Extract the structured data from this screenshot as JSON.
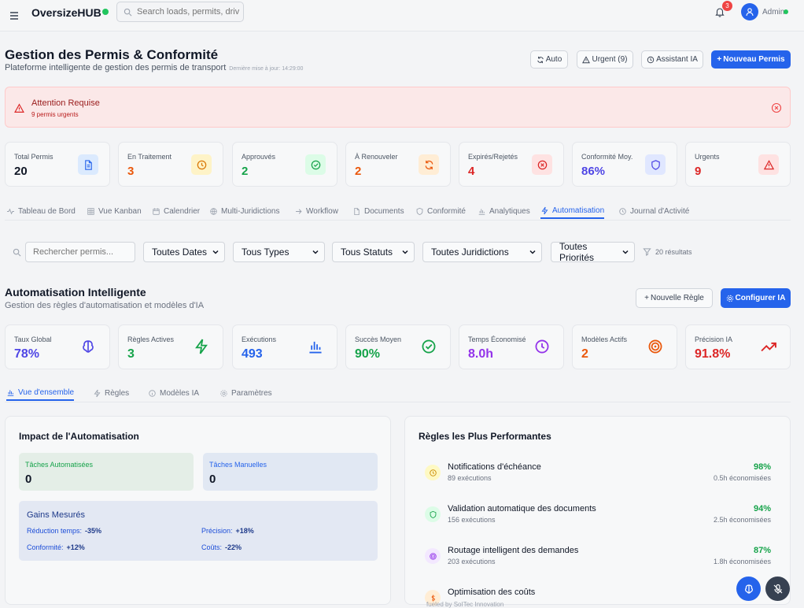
{
  "app": {
    "brand": "OversizeHUB",
    "search_placeholder": "Search loads, permits, drivers...",
    "notif_count": "3",
    "user": "Admin"
  },
  "header": {
    "title": "Gestion des Permis & Conformité",
    "subtitle": "Plateforme intelligente de gestion des permis de transport",
    "last_update": "Dernière mise à jour: 14:29:00"
  },
  "actions": {
    "auto": "Auto",
    "urgent": "Urgent (9)",
    "assistant": "Assistant IA",
    "new_permit": "Nouveau Permis"
  },
  "alert": {
    "title": "Attention Requise",
    "message": "9 permis urgents"
  },
  "stats": [
    {
      "label": "Total Permis",
      "value": "20",
      "icon": "document-icon",
      "color": "#111827",
      "bg": "#dbeafe",
      "ic": "#2563eb"
    },
    {
      "label": "En Traitement",
      "value": "3",
      "icon": "clock-icon",
      "color": "#ea580c",
      "bg": "#fef3c7",
      "ic": "#d97706"
    },
    {
      "label": "Approuvés",
      "value": "2",
      "icon": "check-circle-icon",
      "color": "#16a34a",
      "bg": "#dcfce7",
      "ic": "#16a34a"
    },
    {
      "label": "À Renouveler",
      "value": "2",
      "icon": "refresh-icon",
      "color": "#ea580c",
      "bg": "#ffedd5",
      "ic": "#ea580c"
    },
    {
      "label": "Expirés/Rejetés",
      "value": "4",
      "icon": "x-circle-icon",
      "color": "#dc2626",
      "bg": "#fee2e2",
      "ic": "#dc2626"
    },
    {
      "label": "Conformité Moy.",
      "value": "86%",
      "icon": "shield-icon",
      "color": "#4f46e5",
      "bg": "#e0e7ff",
      "ic": "#4f46e5"
    },
    {
      "label": "Urgents",
      "value": "9",
      "icon": "warning-icon",
      "color": "#dc2626",
      "bg": "#fee2e2",
      "ic": "#dc2626"
    }
  ],
  "tabs": [
    "Tableau de Bord",
    "Vue Kanban",
    "Calendrier",
    "Multi-Juridictions",
    "Workflow",
    "Documents",
    "Conformité",
    "Analytiques",
    "Automatisation",
    "Journal d'Activité"
  ],
  "filters": {
    "search_placeholder": "Rechercher permis...",
    "dates": "Toutes Dates",
    "types": "Tous Types",
    "statuts": "Tous Statuts",
    "juridictions": "Toutes Juridictions",
    "priorites": "Toutes Priorités",
    "results": "20 résultats"
  },
  "automation": {
    "title": "Automatisation Intelligente",
    "subtitle": "Gestion des règles d'automatisation et modèles d'IA",
    "new_rule": "Nouvelle Règle",
    "configure": "Configurer IA",
    "metrics": [
      {
        "label": "Taux Global",
        "value": "78%",
        "icon": "brain-icon",
        "color": "#4f46e5"
      },
      {
        "label": "Règles Actives",
        "value": "3",
        "icon": "lightning-icon",
        "color": "#16a34a"
      },
      {
        "label": "Exécutions",
        "value": "493",
        "icon": "bar-chart-icon",
        "color": "#2563eb"
      },
      {
        "label": "Succès Moyen",
        "value": "90%",
        "icon": "check-circle-icon",
        "color": "#16a34a"
      },
      {
        "label": "Temps Économisé",
        "value": "8.0h",
        "icon": "clock-icon",
        "color": "#9333ea"
      },
      {
        "label": "Modèles Actifs",
        "value": "2",
        "icon": "target-icon",
        "color": "#ea580c"
      },
      {
        "label": "Précision IA",
        "value": "91.8%",
        "icon": "trending-up-icon",
        "color": "#dc2626"
      }
    ],
    "subtabs": [
      "Vue d'ensemble",
      "Règles",
      "Modèles IA",
      "Paramètres"
    ],
    "impact": {
      "title": "Impact de l'Automatisation",
      "auto_label": "Tâches Automatisées",
      "auto_value": "0",
      "manual_label": "Tâches Manuelles",
      "manual_value": "0",
      "gains_title": "Gains Mesurés",
      "gains": [
        {
          "label": "Réduction temps:",
          "value": "-35%"
        },
        {
          "label": "Précision:",
          "value": "+18%"
        },
        {
          "label": "Conformité:",
          "value": "+12%"
        },
        {
          "label": "Coûts:",
          "value": "-22%"
        }
      ]
    },
    "top_rules": {
      "title": "Règles les Plus Performantes",
      "items": [
        {
          "name": "Notifications d'échéance",
          "exec": "89 exécutions",
          "pct": "98%",
          "saved": "0.5h économisées",
          "icon": "clock-icon",
          "bg": "#fef9c3",
          "ic": "#ca8a04"
        },
        {
          "name": "Validation automatique des documents",
          "exec": "156 exécutions",
          "pct": "94%",
          "saved": "2.5h économisées",
          "icon": "shield-icon",
          "bg": "#dcfce7",
          "ic": "#16a34a"
        },
        {
          "name": "Routage intelligent des demandes",
          "exec": "203 exécutions",
          "pct": "87%",
          "saved": "1.8h économisées",
          "icon": "target-icon",
          "bg": "#f3e8ff",
          "ic": "#9333ea"
        },
        {
          "name": "Optimisation des coûts",
          "exec": "",
          "pct": "",
          "saved": "",
          "icon": "dollar-icon",
          "bg": "#ffedd5",
          "ic": "#ea580c"
        }
      ]
    }
  },
  "footer": "fueled by SoITec Innovation"
}
